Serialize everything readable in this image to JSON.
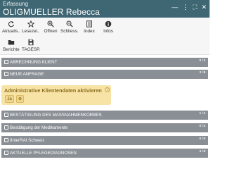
{
  "header": {
    "label": "Erfassung",
    "name": "OLIGMUELLER Rebecca",
    "icons": [
      "minus-icon",
      "more-icon",
      "expand-icon",
      "close-icon"
    ]
  },
  "toolbar": {
    "row1": [
      {
        "name": "refresh-icon",
        "label": "Aktualis..."
      },
      {
        "name": "star-icon",
        "label": "Lesezei..."
      },
      {
        "name": "zoom-in-icon",
        "label": "Öffnen"
      },
      {
        "name": "zoom-out-icon",
        "label": "Schliess..."
      },
      {
        "name": "index-icon",
        "label": "Index"
      },
      {
        "name": "info-icon",
        "label": "Infos"
      }
    ],
    "row2": [
      {
        "name": "folder-icon",
        "label": "Berichte"
      },
      {
        "name": "save-icon",
        "label": "TAGESP..."
      }
    ]
  },
  "sections": {
    "items": [
      {
        "label": "ABRECHNUNG KLIENT",
        "count": "0 / 1"
      },
      {
        "label": "NEUE ANFRAGE",
        "count": "3 / 9"
      },
      {
        "label": "BESTÄTIGUNG DES MASSNAHMENKORBES",
        "count": "1 / 1"
      },
      {
        "label": "Bestätigung der Medikamente",
        "count": "0 / 2"
      },
      {
        "label": "tInterRAI Schweiz",
        "count": "0 / 0"
      },
      {
        "label": "AKTUELLE PFLEGEDIAGNOSEN",
        "count": "4 / 5"
      }
    ]
  },
  "highlight": {
    "title": "Administrative Klientendaten aktivieren",
    "option_yes": "Ja",
    "option_clear": "⊗"
  },
  "colors": {
    "header": "#3f6773",
    "bar": "#8a8f95",
    "highlight": "#f8e3a6"
  }
}
